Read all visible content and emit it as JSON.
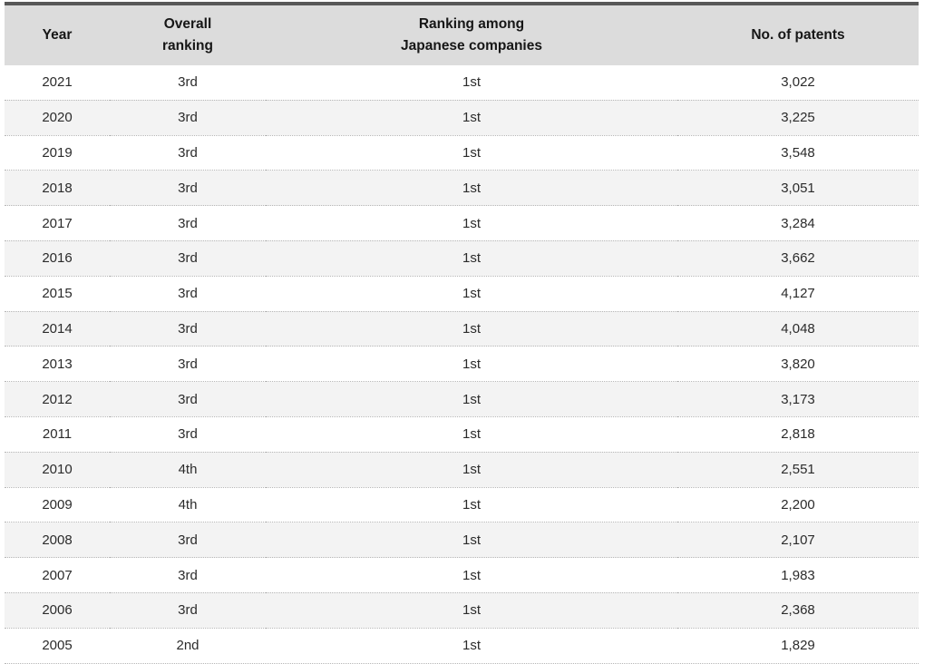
{
  "table": {
    "columns": [
      {
        "key": "year",
        "header_lines": [
          "Year"
        ]
      },
      {
        "key": "overall",
        "header_lines": [
          "Overall",
          "ranking"
        ]
      },
      {
        "key": "japanese",
        "header_lines": [
          "Ranking among",
          "Japanese companies"
        ]
      },
      {
        "key": "patents",
        "header_lines": [
          "No. of patents"
        ]
      }
    ],
    "header": {
      "year": "Year",
      "overall_line1": "Overall",
      "overall_line2": "ranking",
      "japanese_line1": "Ranking among",
      "japanese_line2": "Japanese companies",
      "patents": "No. of patents"
    },
    "rows": [
      {
        "year": "2021",
        "overall": "3rd",
        "japanese": "1st",
        "patents": "3,022"
      },
      {
        "year": "2020",
        "overall": "3rd",
        "japanese": "1st",
        "patents": "3,225"
      },
      {
        "year": "2019",
        "overall": "3rd",
        "japanese": "1st",
        "patents": "3,548"
      },
      {
        "year": "2018",
        "overall": "3rd",
        "japanese": "1st",
        "patents": "3,051"
      },
      {
        "year": "2017",
        "overall": "3rd",
        "japanese": "1st",
        "patents": "3,284"
      },
      {
        "year": "2016",
        "overall": "3rd",
        "japanese": "1st",
        "patents": "3,662"
      },
      {
        "year": "2015",
        "overall": "3rd",
        "japanese": "1st",
        "patents": "4,127"
      },
      {
        "year": "2014",
        "overall": "3rd",
        "japanese": "1st",
        "patents": "4,048"
      },
      {
        "year": "2013",
        "overall": "3rd",
        "japanese": "1st",
        "patents": "3,820"
      },
      {
        "year": "2012",
        "overall": "3rd",
        "japanese": "1st",
        "patents": "3,173"
      },
      {
        "year": "2011",
        "overall": "3rd",
        "japanese": "1st",
        "patents": "2,818"
      },
      {
        "year": "2010",
        "overall": "4th",
        "japanese": "1st",
        "patents": "2,551"
      },
      {
        "year": "2009",
        "overall": "4th",
        "japanese": "1st",
        "patents": "2,200"
      },
      {
        "year": "2008",
        "overall": "3rd",
        "japanese": "1st",
        "patents": "2,107"
      },
      {
        "year": "2007",
        "overall": "3rd",
        "japanese": "1st",
        "patents": "1,983"
      },
      {
        "year": "2006",
        "overall": "3rd",
        "japanese": "1st",
        "patents": "2,368"
      },
      {
        "year": "2005",
        "overall": "2nd",
        "japanese": "1st",
        "patents": "1,829"
      }
    ]
  },
  "colors": {
    "top_rule": "#585858",
    "header_background": "#dcdcdc",
    "row_alt_background": "#f3f3f3",
    "row_background": "#ffffff",
    "separator": "#b6b6b6",
    "text": "#2b2b2b",
    "header_text": "#161616"
  }
}
